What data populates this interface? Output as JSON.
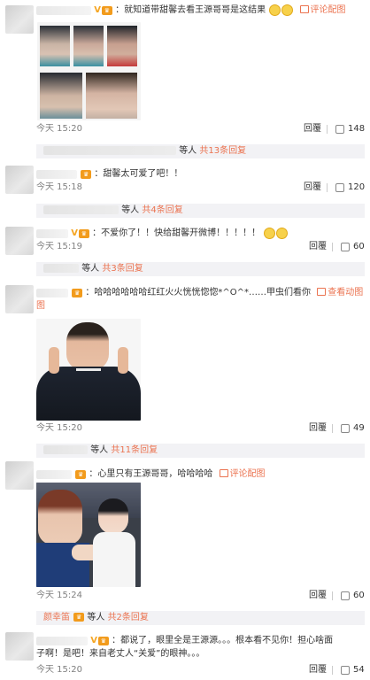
{
  "comments": [
    {
      "text": "：就知道带甜馨去看王源哥哥是这结果",
      "pic_link": "评论配图",
      "time": "今天 15:20",
      "reply": "回覆",
      "likes": "148",
      "sub": {
        "prefix": "等人",
        "link": "共13条回复"
      }
    },
    {
      "text": "：甜馨太可爱了吧！！",
      "time": "今天 15:18",
      "reply": "回覆",
      "likes": "120",
      "sub": {
        "prefix": "等人",
        "link": "共4条回复"
      }
    },
    {
      "text": "：不爱你了！！快给甜馨开微博！！！！！",
      "time": "今天 15:19",
      "reply": "回覆",
      "likes": "60",
      "sub": {
        "prefix": "等人",
        "link": "共3条回复"
      }
    },
    {
      "text": "：哈哈哈哈哈哈红红火火恍恍惚惚*^O^*……甲虫们看你",
      "pic_link": "查看动图",
      "text_wrap": "图",
      "time": "今天 15:20",
      "reply": "回覆",
      "likes": "49",
      "sub": {
        "prefix": "等人",
        "link": "共11条回复"
      }
    },
    {
      "text": "：心里只有王源哥哥，哈哈哈哈",
      "pic_link": "评论配图",
      "time": "今天 15:24",
      "reply": "回覆",
      "likes": "60",
      "sub": {
        "user": "颜幸笛",
        "prefix": "等人",
        "link": "共2条回复"
      }
    },
    {
      "text": "：都说了，眼里全是王源源。。。根本看不见你！担心啥面",
      "text_wrap": "子啊！是吧！来自老丈人“关爱”的眼神。。。",
      "time": "今天 15:20",
      "reply": "回覆",
      "likes": "54"
    }
  ],
  "icons": {
    "vip": "v-vip-icon",
    "crown": "crown-badge-icon",
    "picture": "picture-icon",
    "like": "thumbs-up-icon",
    "emoji": "emoji-icon"
  },
  "colors": {
    "link": "#eb7350",
    "subbar": "#f2f2f5",
    "badge": "#f29b1c"
  }
}
